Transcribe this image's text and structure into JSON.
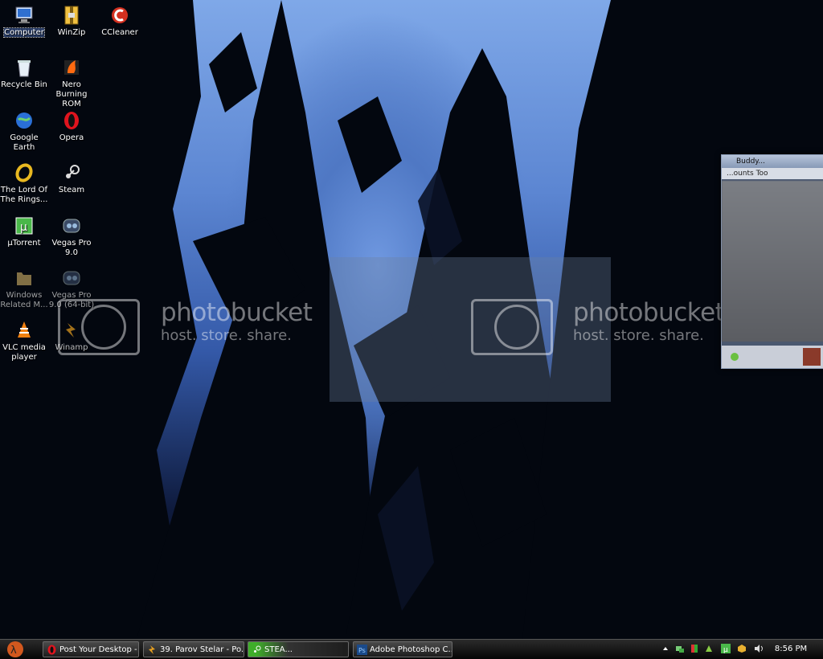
{
  "desktop": {
    "icons": [
      {
        "label": "Computer",
        "icon": "computer-icon"
      },
      {
        "label": "WinZip",
        "icon": "winzip-icon"
      },
      {
        "label": "CCleaner",
        "icon": "ccleaner-icon"
      },
      {
        "label": "Recycle Bin",
        "icon": "recycle-bin-icon"
      },
      {
        "label": "Nero Burning ROM",
        "icon": "nero-icon"
      },
      {
        "label": "Google Earth",
        "icon": "google-earth-icon"
      },
      {
        "label": "Opera",
        "icon": "opera-icon"
      },
      {
        "label": "The Lord Of The Rings...",
        "icon": "ring-icon"
      },
      {
        "label": "Steam",
        "icon": "steam-icon"
      },
      {
        "label": "µTorrent",
        "icon": "utorrent-icon"
      },
      {
        "label": "Vegas Pro 9.0",
        "icon": "vegas-icon"
      },
      {
        "label": "Windows Related M...",
        "icon": "folder-icon"
      },
      {
        "label": "Vegas Pro 9.0 (64-bit)",
        "icon": "vegas-icon"
      },
      {
        "label": "VLC media player",
        "icon": "vlc-icon"
      },
      {
        "label": "Winamp",
        "icon": "winamp-icon"
      }
    ]
  },
  "watermark": {
    "brand": "photobucket",
    "tagline": "host. store. share."
  },
  "buddy_window": {
    "title": "Buddy...",
    "menu": "...ounts  Too"
  },
  "taskbar": {
    "tasks": [
      {
        "label": "Post Your Desktop - ...",
        "icon": "opera-icon"
      },
      {
        "label": "39. Parov Stelar - Po...",
        "icon": "winamp-icon"
      },
      {
        "label": "STEA...",
        "icon": "steam-icon"
      },
      {
        "label": "Adobe Photoshop C...",
        "icon": "photoshop-icon"
      }
    ],
    "clock": "8:56 PM"
  },
  "colors": {
    "sky": "#5c86d2",
    "taskbar": "#0b0b0b"
  }
}
